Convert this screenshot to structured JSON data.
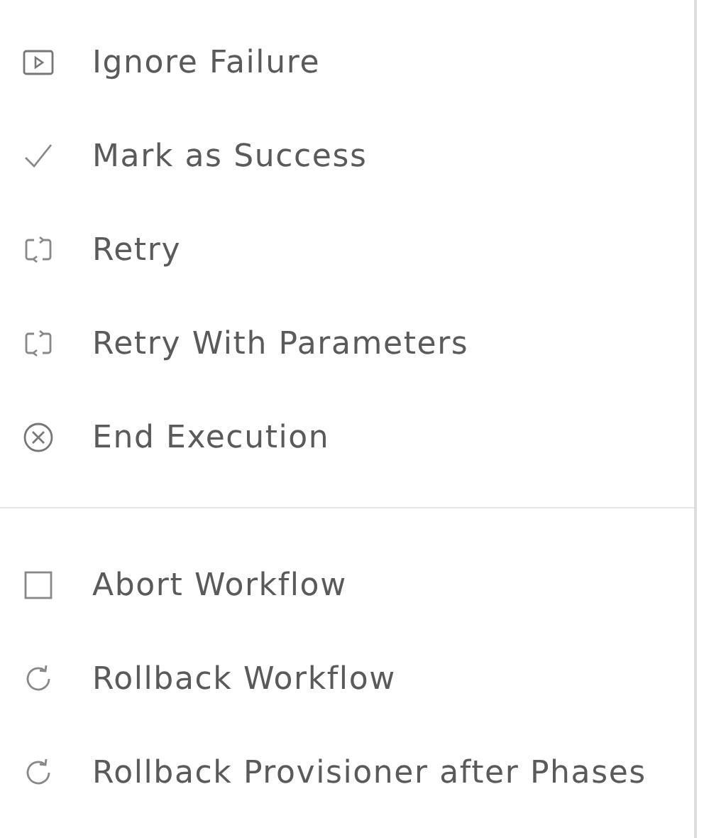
{
  "menu": {
    "groups": [
      {
        "items": [
          {
            "label": "Ignore Failure",
            "kind": "play"
          },
          {
            "label": "Mark as Success",
            "kind": "check"
          },
          {
            "label": "Retry",
            "kind": "retry"
          },
          {
            "label": "Retry With Parameters",
            "kind": "retry"
          },
          {
            "label": "End Execution",
            "kind": "cancel"
          }
        ]
      },
      {
        "items": [
          {
            "label": "Abort Workflow",
            "kind": "stop"
          },
          {
            "label": "Rollback Workflow",
            "kind": "rollback"
          },
          {
            "label": "Rollback Provisioner after Phases",
            "kind": "rollback"
          }
        ]
      }
    ]
  }
}
